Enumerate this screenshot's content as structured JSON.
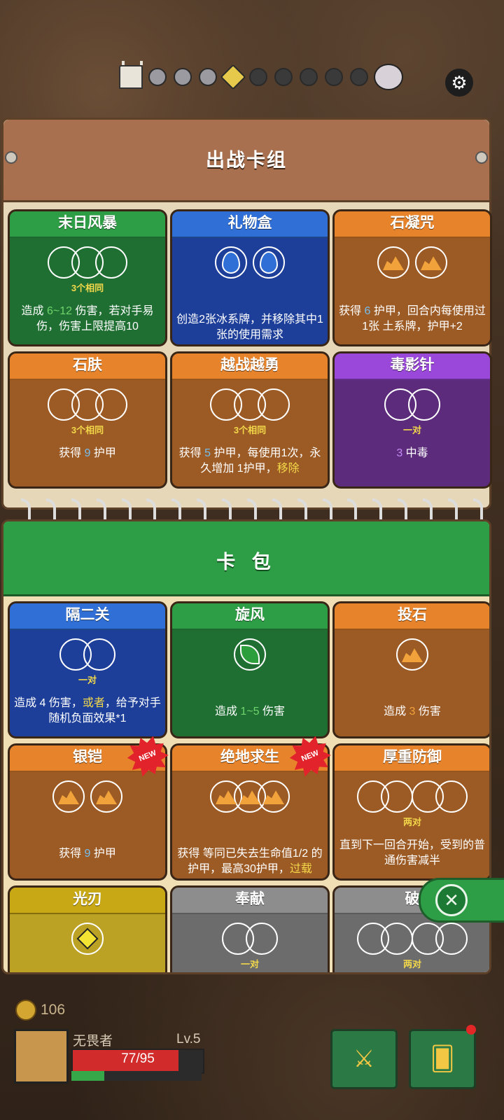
{
  "colors": {
    "green": "#2e9e46",
    "blue": "#2f6fd6",
    "orange": "#e7832a",
    "purple": "#9a48d9",
    "yellow": "#c9a816",
    "gray": "#8d8d8d",
    "body_green": "#1f6e32",
    "body_blue": "#1d3f9a",
    "body_orange": "#9c5a24",
    "body_purple": "#5c2b7c",
    "body_yellow": "#bba224",
    "body_gray": "#6c6c6c"
  },
  "progress": {
    "castle_icon": "castle-icon",
    "dots": [
      "gray",
      "gray",
      "gray",
      "gem",
      "dark",
      "dark",
      "dark",
      "dark",
      "dark"
    ],
    "boss_icon": "boss-skull-icon",
    "settings_icon": "gear-icon"
  },
  "deck": {
    "title": "出战卡组",
    "cards": [
      {
        "title": "末日风暴",
        "color": "green",
        "slots": 3,
        "slot_icon": "",
        "label": "3个相同",
        "desc_parts": [
          [
            "造成 ",
            ""
          ],
          [
            "6~12",
            "gl"
          ],
          [
            " 伤害，若对手",
            ""
          ],
          [
            "易伤，伤害上限提高10",
            ""
          ]
        ]
      },
      {
        "title": "礼物盒",
        "color": "blue",
        "slots": 2,
        "sep": true,
        "slot_icon": "drop",
        "label": "",
        "desc_parts": [
          [
            "创造2张冰系牌，并移除其中1张的使用需求",
            ""
          ]
        ]
      },
      {
        "title": "石凝咒",
        "color": "orange",
        "slots": 2,
        "sep": true,
        "slot_icon": "earth",
        "label": "",
        "desc_parts": [
          [
            "获得 ",
            ""
          ],
          [
            "6",
            "bl"
          ],
          [
            " 护甲，回合内每使用过1张 ",
            ""
          ],
          [
            "土系牌，",
            ""
          ],
          [
            "护甲+2",
            ""
          ]
        ]
      },
      {
        "title": "石肤",
        "color": "orange",
        "slots": 3,
        "slot_icon": "",
        "label": "3个相同",
        "desc_parts": [
          [
            "获得 ",
            ""
          ],
          [
            "9",
            "bl"
          ],
          [
            " 护甲",
            ""
          ]
        ]
      },
      {
        "title": "越战越勇",
        "color": "orange",
        "slots": 3,
        "slot_icon": "",
        "label": "3个相同",
        "desc_parts": [
          [
            "获得 ",
            ""
          ],
          [
            "5",
            "bl"
          ],
          [
            " 护甲，每使用1次，永久增加 ",
            ""
          ],
          [
            "1护甲，",
            ""
          ],
          [
            "移除",
            "hl"
          ]
        ]
      },
      {
        "title": "毒影针",
        "color": "purple",
        "slots": 2,
        "slot_icon": "",
        "label": "一对",
        "desc_parts": [
          [
            "3",
            "pl"
          ],
          [
            " 中毒",
            ""
          ]
        ]
      }
    ]
  },
  "pack": {
    "title": "卡 包",
    "cards": [
      {
        "title": "隔二关",
        "color": "blue",
        "slots": 2,
        "slot_icon": "",
        "label": "一对",
        "desc_parts": [
          [
            "造成 ",
            ""
          ],
          [
            "4",
            ""
          ],
          [
            " 伤害，",
            ""
          ],
          [
            "或者",
            "hl"
          ],
          [
            "，给予对手随机负面效果*1",
            ""
          ]
        ]
      },
      {
        "title": "旋风",
        "color": "green",
        "slots": 1,
        "slot_icon": "leaf",
        "label": "",
        "desc_parts": [
          [
            "造成 ",
            ""
          ],
          [
            "1~5",
            "gl"
          ],
          [
            " 伤害",
            ""
          ]
        ]
      },
      {
        "title": "投石",
        "color": "orange",
        "slots": 1,
        "slot_icon": "earth",
        "label": "",
        "desc_parts": [
          [
            "造成 ",
            ""
          ],
          [
            "3",
            "or"
          ],
          [
            " 伤害",
            ""
          ]
        ]
      },
      {
        "title": "银铠",
        "color": "orange",
        "slots": 2,
        "sep": true,
        "slot_icon": "earth",
        "label": "",
        "new": true,
        "desc_parts": [
          [
            "获得 ",
            ""
          ],
          [
            "9",
            "bl"
          ],
          [
            " 护甲",
            ""
          ]
        ]
      },
      {
        "title": "绝地求生",
        "color": "orange",
        "slots": 3,
        "slot_icon": "earth",
        "label": "",
        "new": true,
        "desc_parts": [
          [
            "获得 等同已失去",
            ""
          ],
          [
            "生命值1/2 的护甲，最高30护甲，",
            ""
          ],
          [
            "过载",
            "hl"
          ]
        ]
      },
      {
        "title": "厚重防御",
        "color": "orange",
        "slots": 4,
        "pairs": true,
        "slot_icon": "",
        "label": "两对",
        "desc_parts": [
          [
            "直到下一回合开始，受到的普通伤害减半",
            ""
          ]
        ]
      },
      {
        "title": "光刃",
        "color": "yellow",
        "slots": 1,
        "slot_icon": "diamond",
        "label": "",
        "desc_parts": []
      },
      {
        "title": "奉献",
        "color": "gray",
        "slots": 2,
        "slot_icon": "",
        "label": "一对",
        "desc_parts": []
      },
      {
        "title": "破",
        "color": "gray",
        "slots": 4,
        "pairs": true,
        "slot_icon": "",
        "label": "两对",
        "desc_parts": []
      }
    ],
    "badge_new": "NEW",
    "close_icon": "close-x-icon"
  },
  "player": {
    "coins": "106",
    "name": "无畏者",
    "level": "Lv.5",
    "hp": "77/95",
    "hp_fraction": 0.81,
    "xp_fraction": 0.25,
    "equipment_icon": "winged-helmet-icon",
    "cards_icon": "cards-icon"
  }
}
